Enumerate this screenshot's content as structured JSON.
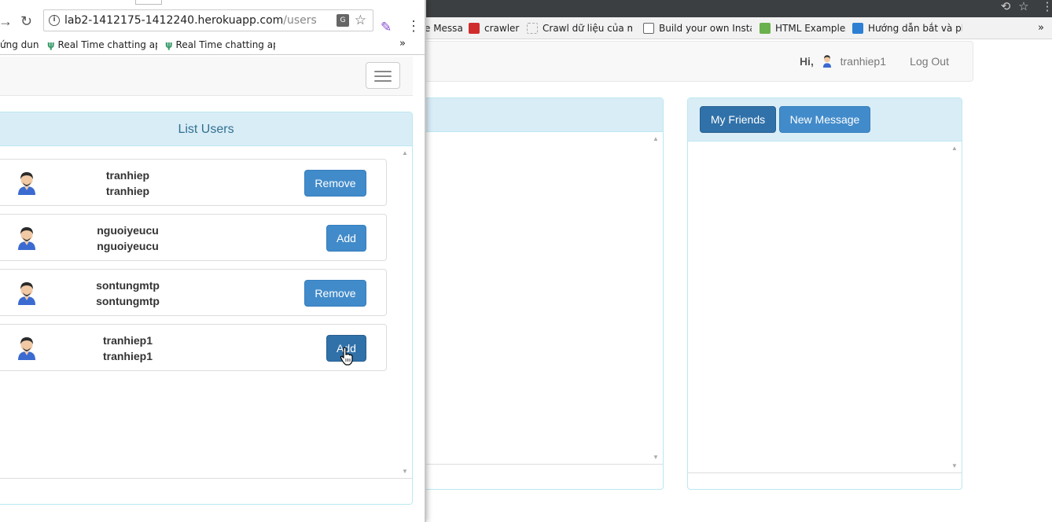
{
  "background": {
    "bookmarks": [
      {
        "label": "e Messa",
        "color": "#ffffff"
      },
      {
        "label": "crawler",
        "color": "#d12c2c"
      },
      {
        "label": "Crawl dữ liệu của một",
        "color": "#e0e0e0"
      },
      {
        "label": "Build your own Instag",
        "color": "#ffffff"
      },
      {
        "label": "HTML Examples",
        "color": "#6ab04c"
      },
      {
        "label": "Hướng dẫn bắt và phá",
        "color": "#2d7fd3"
      }
    ],
    "navbar": {
      "greeting": "Hi,",
      "username": "tranhiep1",
      "logout": "Log Out"
    },
    "right_panel": {
      "my_friends": "My Friends",
      "new_message": "New Message"
    }
  },
  "popup": {
    "url_host": "lab2-1412175-1412240.herokuapp.com",
    "url_path": "/users",
    "bookmarks": [
      {
        "label": "ứng dung"
      },
      {
        "label": "Real Time chatting ap"
      },
      {
        "label": "Real Time chatting ap"
      }
    ],
    "bookmarks_more": "»",
    "list_title": "List Users",
    "users": [
      {
        "name": "tranhiep",
        "username": "tranhiep",
        "action": "Remove"
      },
      {
        "name": "nguoiyeucu",
        "username": "nguoiyeucu",
        "action": "Add"
      },
      {
        "name": "sontungmtp",
        "username": "sontungmtp",
        "action": "Remove"
      },
      {
        "name": "tranhiep1",
        "username": "tranhiep1",
        "action": "Add"
      }
    ]
  },
  "colors": {
    "primary": "#428bca",
    "panel_heading": "#d9edf7",
    "panel_border": "#bce8f1"
  }
}
